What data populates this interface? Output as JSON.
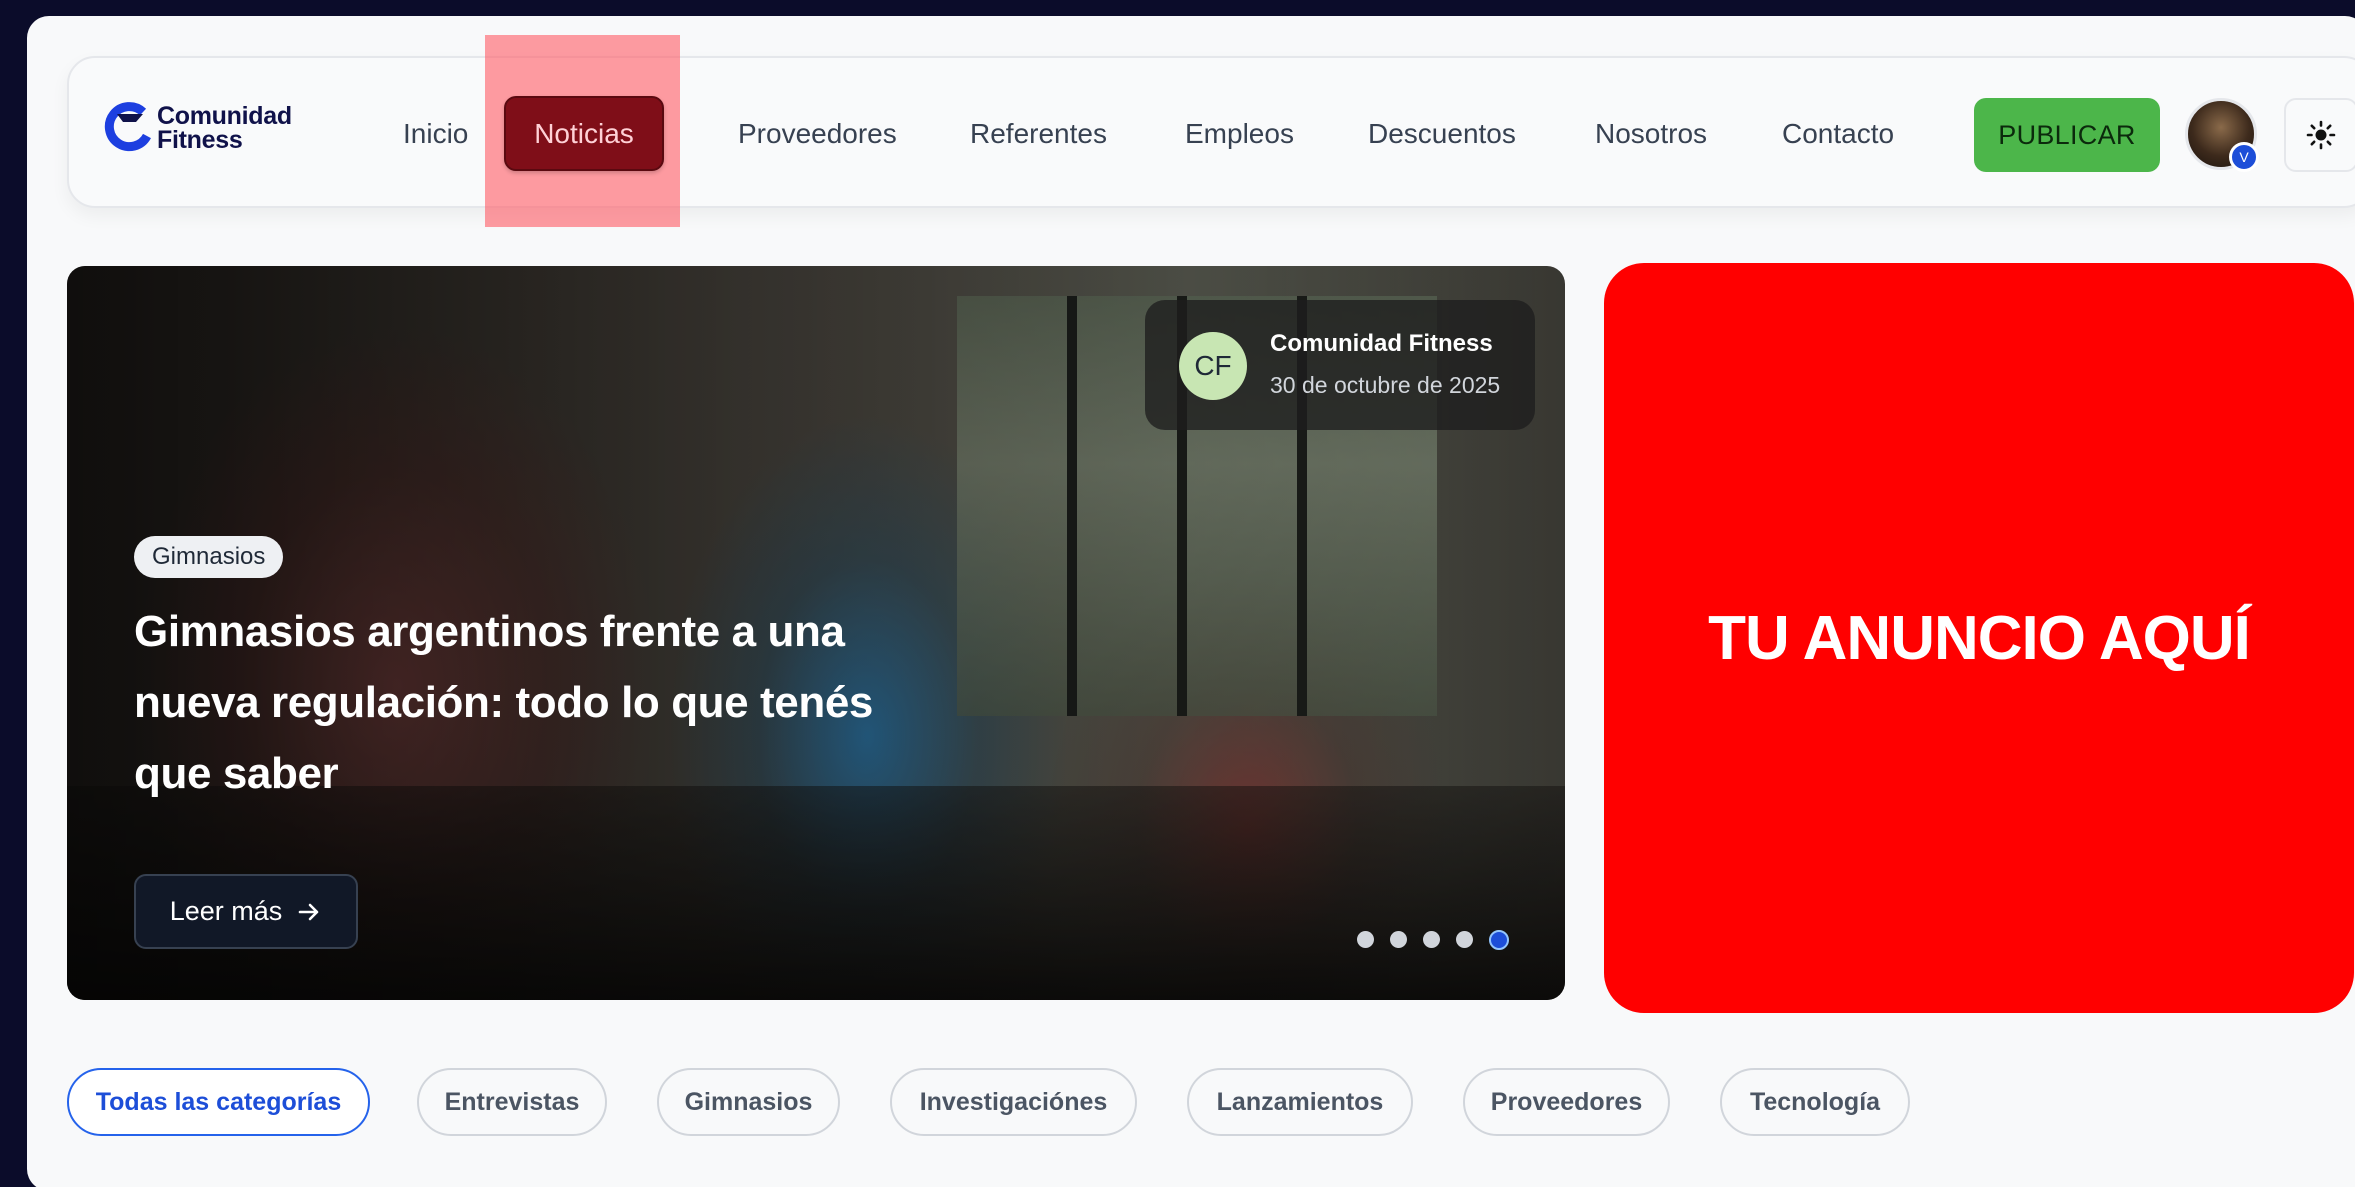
{
  "brand": {
    "logo_line1": "Comunidad",
    "logo_line2": "Fitness",
    "accent": "#1d4ed8"
  },
  "nav": {
    "items": [
      {
        "label": "Inicio"
      },
      {
        "label": "Noticias",
        "active": true
      },
      {
        "label": "Proveedores"
      },
      {
        "label": "Referentes"
      },
      {
        "label": "Empleos"
      },
      {
        "label": "Descuentos"
      },
      {
        "label": "Nosotros"
      },
      {
        "label": "Contacto"
      }
    ],
    "publish_label": "PUBLICAR",
    "publish_color": "#4cb64a",
    "active_color": "#7f0e18",
    "avatar_badge": "V",
    "theme_icon": "sun-icon"
  },
  "hero": {
    "tag": "Gimnasios",
    "title": "Gimnasios argentinos frente a una nueva regulación: todo lo que tenés que saber",
    "read_more_label": "Leer más",
    "author": {
      "initials": "CF",
      "name": "Comunidad Fitness",
      "date": "30 de octubre de 2025"
    },
    "slide_count": 5,
    "active_slide": 5
  },
  "ad": {
    "text": "TU ANUNCIO AQUÍ",
    "color": "#ff0000"
  },
  "categories": [
    {
      "label": "Todas las categorías",
      "active": true
    },
    {
      "label": "Entrevistas"
    },
    {
      "label": "Gimnasios"
    },
    {
      "label": "Investigaciónes"
    },
    {
      "label": "Lanzamientos"
    },
    {
      "label": "Proveedores"
    },
    {
      "label": "Tecnología"
    }
  ]
}
